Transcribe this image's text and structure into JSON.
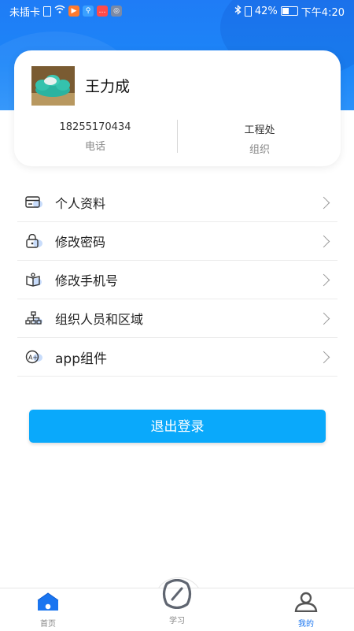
{
  "status_bar": {
    "carrier": "未插卡",
    "battery": "42%",
    "battery_level": 0.42,
    "time": "下午4:20"
  },
  "profile": {
    "name": "王力成",
    "phone": "18255170434",
    "phone_label": "电话",
    "org": "工程处",
    "org_label": "组织"
  },
  "menu": {
    "items": [
      {
        "label": "个人资料",
        "icon": "id-card-icon"
      },
      {
        "label": "修改密码",
        "icon": "lock-icon"
      },
      {
        "label": "修改手机号",
        "icon": "book-icon"
      },
      {
        "label": "组织人员和区域",
        "icon": "org-chart-icon"
      },
      {
        "label": "app组件",
        "icon": "app-widget-icon"
      }
    ]
  },
  "logout_label": "退出登录",
  "tabbar": {
    "tabs": [
      {
        "label": "首页",
        "icon": "home-icon"
      },
      {
        "label": "学习",
        "icon": "study-icon"
      },
      {
        "label": "我的",
        "icon": "user-icon",
        "active": true
      }
    ]
  },
  "colors": {
    "primary": "#1f7cf6",
    "button": "#0aa9fb",
    "active_tab": "#1a75f0"
  }
}
